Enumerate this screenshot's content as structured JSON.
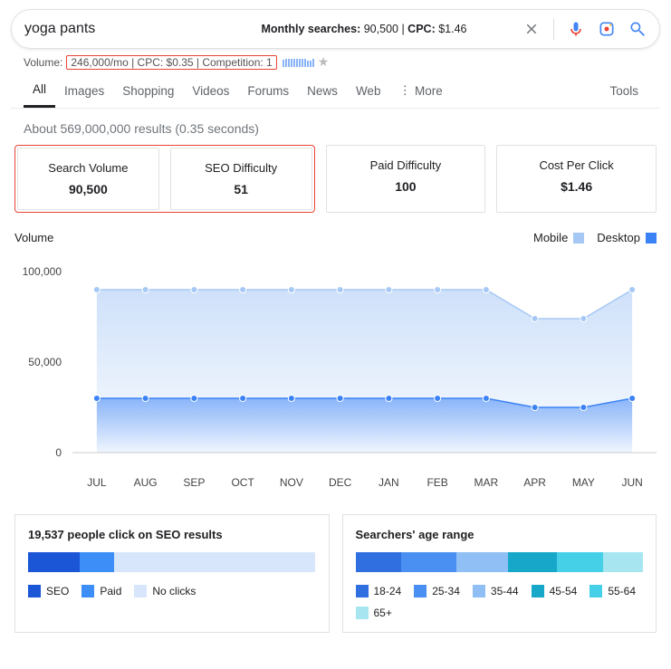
{
  "search": {
    "query": "yoga pants",
    "monthly_label": "Monthly searches:",
    "monthly_value": "90,500",
    "cpc_label": "CPC:",
    "cpc_value": "$1.46",
    "volume_prefix": "Volume:",
    "volume_highlight": "246,000/mo | CPC: $0.35 | Competition: 1"
  },
  "tabs": {
    "all": "All",
    "images": "Images",
    "shopping": "Shopping",
    "videos": "Videos",
    "forums": "Forums",
    "news": "News",
    "web": "Web",
    "more": "More",
    "tools": "Tools"
  },
  "results_meta": "About 569,000,000 results (0.35 seconds)",
  "stats": {
    "search_volume": {
      "label": "Search Volume",
      "value": "90,500"
    },
    "seo_difficulty": {
      "label": "SEO Difficulty",
      "value": "51"
    },
    "paid_difficulty": {
      "label": "Paid Difficulty",
      "value": "100"
    },
    "cpc": {
      "label": "Cost Per Click",
      "value": "$1.46"
    }
  },
  "chart": {
    "title": "Volume",
    "legend_mobile": "Mobile",
    "legend_desktop": "Desktop",
    "legend_mobile_color": "#a6c8f5",
    "legend_desktop_color": "#1a73e8"
  },
  "chart_data": {
    "type": "line",
    "title": "Volume",
    "xlabel": "",
    "ylabel": "",
    "ylim": [
      0,
      100000
    ],
    "y_ticks": [
      0,
      50000,
      100000
    ],
    "categories": [
      "JUL",
      "AUG",
      "SEP",
      "OCT",
      "NOV",
      "DEC",
      "JAN",
      "FEB",
      "MAR",
      "APR",
      "MAY",
      "JUN"
    ],
    "series": [
      {
        "name": "Mobile",
        "color": "#a6c8f5",
        "values": [
          90000,
          90000,
          90000,
          90000,
          90000,
          90000,
          90000,
          90000,
          90000,
          74000,
          74000,
          90000
        ]
      },
      {
        "name": "Desktop",
        "color": "#3b82f6",
        "values": [
          30000,
          30000,
          30000,
          30000,
          30000,
          30000,
          30000,
          30000,
          30000,
          25000,
          25000,
          30000
        ]
      }
    ]
  },
  "clicks_panel": {
    "title": "19,537 people click on SEO results",
    "legend_seo": "SEO",
    "legend_paid": "Paid",
    "legend_none": "No clicks",
    "segments": [
      {
        "name": "SEO",
        "color": "#1a56d6",
        "pct": 18
      },
      {
        "name": "Paid",
        "color": "#3e8ef7",
        "pct": 12
      },
      {
        "name": "No clicks",
        "color": "#d7e6fb",
        "pct": 70
      }
    ]
  },
  "age_panel": {
    "title": "Searchers' age range",
    "brackets": [
      "18-24",
      "25-34",
      "35-44",
      "45-54",
      "55-64",
      "65+"
    ],
    "segments": [
      {
        "label": "18-24",
        "color": "#2f6fe0",
        "pct": 16
      },
      {
        "label": "25-34",
        "color": "#4a90f2",
        "pct": 19
      },
      {
        "label": "35-44",
        "color": "#8fbff5",
        "pct": 18
      },
      {
        "label": "45-54",
        "color": "#17a7c9",
        "pct": 17
      },
      {
        "label": "55-64",
        "color": "#45d0e8",
        "pct": 16
      },
      {
        "label": "65+",
        "color": "#a7e6f0",
        "pct": 14
      }
    ]
  }
}
